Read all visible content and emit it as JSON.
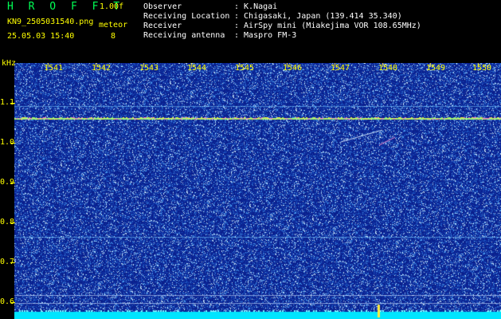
{
  "header": {
    "logo": "H R O F F T",
    "version": "1.00f",
    "filename": "KN9_2505031540.png",
    "timestamp": "25.05.03 15:40",
    "meteor_label": "meteor",
    "meteor_count": "8"
  },
  "info": [
    {
      "label": "Observer",
      "value": ": K.Nagai"
    },
    {
      "label": "Receiving Location",
      "value": ": Chigasaki, Japan (139.414 35.340)"
    },
    {
      "label": "Receiver",
      "value": ": AirSpy mini (Miakejima VOR 108.65MHz)"
    },
    {
      "label": "Receiving antenna",
      "value": ": Maspro FM-3"
    }
  ],
  "spectrogram": {
    "y_unit": "kHz",
    "y_ticks": [
      "1.1",
      "1.0",
      "0.9",
      "0.8",
      "0.7",
      "0.6"
    ],
    "x_ticks": [
      "1541",
      "1542",
      "1543",
      "1544",
      "1545",
      "1546",
      "1547",
      "1548",
      "1549",
      "1550"
    ],
    "colors": {
      "background": "#0a1f8c",
      "noise_light": "#bfe6ff",
      "carrier": "#ffeb3b",
      "bottom_band": "#00e5ff"
    }
  }
}
